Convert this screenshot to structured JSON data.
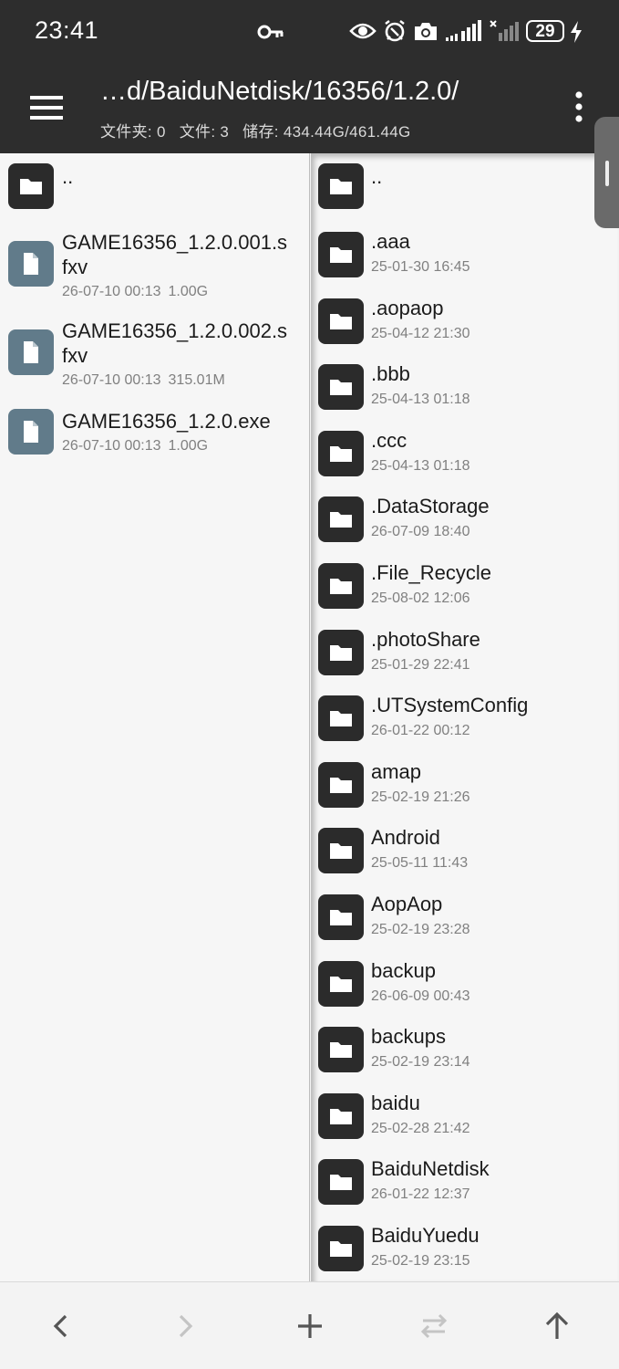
{
  "status": {
    "time": "23:41",
    "battery": "29",
    "icons": [
      "key-icon",
      "eye-icon",
      "alarm-icon",
      "camera-icon",
      "signal-icon",
      "signal-x-icon",
      "battery-icon",
      "charging-icon"
    ]
  },
  "header": {
    "path": "…d/BaiduNetdisk/16356/1.2.0/",
    "folders": "文件夹: 0",
    "files": "文件: 3",
    "storage": "储存: 434.44G/461.44G",
    "menu_icon": "hamburger-menu-icon",
    "more_icon": "more-vert-icon"
  },
  "left_pane": {
    "parent": "..",
    "items": [
      {
        "line1": "GAME16356_1.2.0.001.s",
        "line2": "fxv",
        "date": "26-07-10 00:13",
        "size": "1.00G"
      },
      {
        "line1": "GAME16356_1.2.0.002.s",
        "line2": "fxv",
        "date": "26-07-10 00:13",
        "size": "315.01M"
      },
      {
        "line1": "GAME16356_1.2.0.exe",
        "line2": "",
        "date": "26-07-10 00:13",
        "size": "1.00G"
      }
    ]
  },
  "right_pane": {
    "parent": "..",
    "items": [
      {
        "name": ".aaa",
        "date": "25-01-30 16:45"
      },
      {
        "name": ".aopaop",
        "date": "25-04-12 21:30"
      },
      {
        "name": ".bbb",
        "date": "25-04-13 01:18"
      },
      {
        "name": ".ccc",
        "date": "25-04-13 01:18"
      },
      {
        "name": ".DataStorage",
        "date": "26-07-09 18:40"
      },
      {
        "name": ".File_Recycle",
        "date": "25-08-02 12:06"
      },
      {
        "name": ".photoShare",
        "date": "25-01-29 22:41"
      },
      {
        "name": ".UTSystemConfig",
        "date": "26-01-22 00:12"
      },
      {
        "name": "amap",
        "date": "25-02-19 21:26"
      },
      {
        "name": "Android",
        "date": "25-05-11 11:43"
      },
      {
        "name": "AopAop",
        "date": "25-02-19 23:28"
      },
      {
        "name": "backup",
        "date": "26-06-09 00:43"
      },
      {
        "name": "backups",
        "date": "25-02-19 23:14"
      },
      {
        "name": "baidu",
        "date": "25-02-28 21:42"
      },
      {
        "name": "BaiduNetdisk",
        "date": "26-01-22 12:37"
      },
      {
        "name": "BaiduYuedu",
        "date": "25-02-19 23:15"
      }
    ]
  },
  "bottom_bar": [
    "back-icon",
    "forward-icon",
    "add-icon",
    "swap-icon",
    "up-icon"
  ],
  "colors": {
    "header_bg": "#2d2d2d",
    "folder_icon_bg": "#2b2b2b",
    "file_icon_bg": "#617b8a",
    "pane_bg": "#f6f6f6"
  }
}
